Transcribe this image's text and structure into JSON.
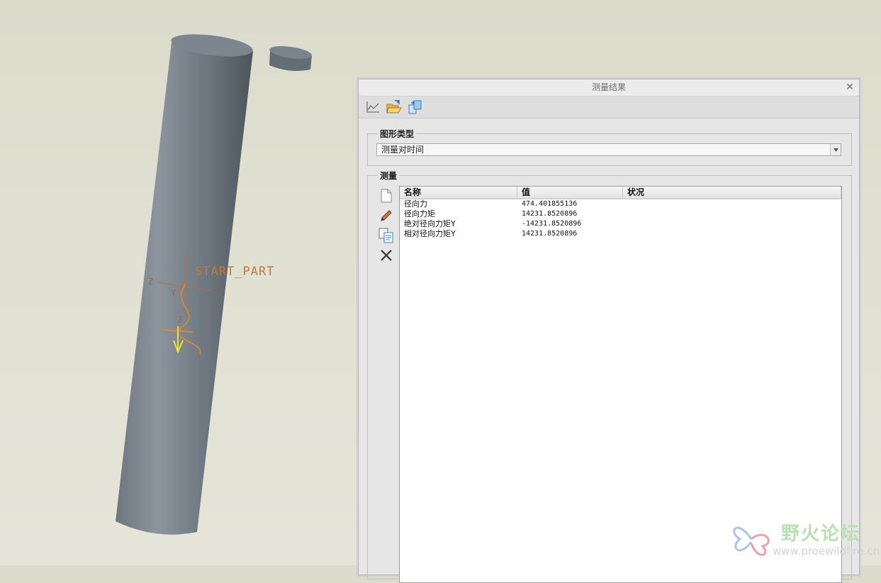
{
  "viewport": {
    "csys_label": "START_PART",
    "axis_labels": [
      "Z",
      "Y",
      "X",
      "Z"
    ]
  },
  "dialog": {
    "title": "测量结果",
    "toolbar": {
      "icons": [
        "graph-icon",
        "open-folder-icon",
        "export-icon"
      ]
    },
    "graph_type": {
      "legend": "图形类型",
      "selected": "测量对时间"
    },
    "measures": {
      "legend": "测量",
      "side_icons": [
        "new-icon",
        "edit-icon",
        "copy-icon",
        "delete-icon"
      ],
      "columns": [
        "名称",
        "值",
        "状况"
      ],
      "rows": [
        {
          "name": "径向力",
          "value": "474.401855136",
          "status": ""
        },
        {
          "name": "径向力矩",
          "value": "14231.8520896",
          "status": ""
        },
        {
          "name": "绝对径向力矩Y",
          "value": "-14231.8520896",
          "status": ""
        },
        {
          "name": "相对径向力矩Y",
          "value": "14231.8520896",
          "status": ""
        }
      ]
    }
  },
  "watermark": {
    "title": "野火论坛",
    "url": "www.proewildfire.cn"
  }
}
